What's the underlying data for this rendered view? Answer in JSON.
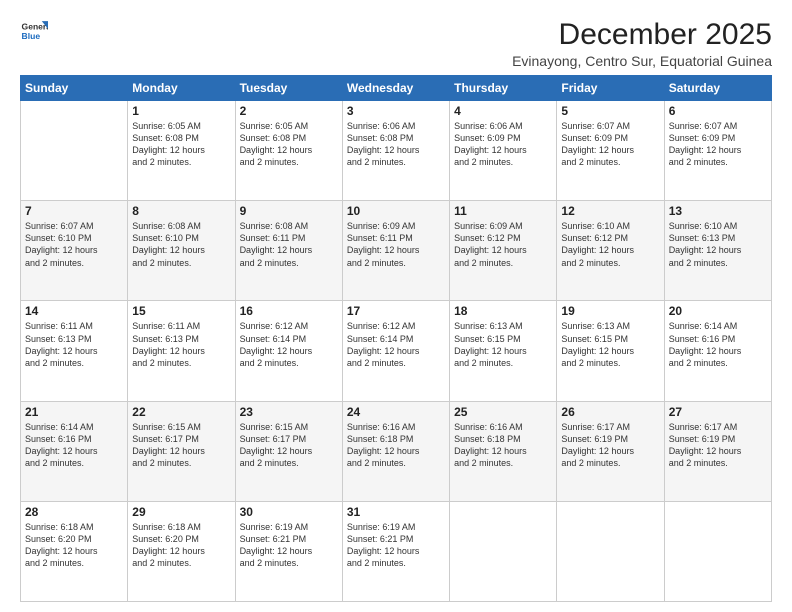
{
  "logo": {
    "general": "General",
    "blue": "Blue"
  },
  "title": "December 2025",
  "subtitle": "Evinayong, Centro Sur, Equatorial Guinea",
  "weekdays": [
    "Sunday",
    "Monday",
    "Tuesday",
    "Wednesday",
    "Thursday",
    "Friday",
    "Saturday"
  ],
  "weeks": [
    [
      {
        "day": "",
        "info": ""
      },
      {
        "day": "1",
        "info": "Sunrise: 6:05 AM\nSunset: 6:08 PM\nDaylight: 12 hours\nand 2 minutes."
      },
      {
        "day": "2",
        "info": "Sunrise: 6:05 AM\nSunset: 6:08 PM\nDaylight: 12 hours\nand 2 minutes."
      },
      {
        "day": "3",
        "info": "Sunrise: 6:06 AM\nSunset: 6:08 PM\nDaylight: 12 hours\nand 2 minutes."
      },
      {
        "day": "4",
        "info": "Sunrise: 6:06 AM\nSunset: 6:09 PM\nDaylight: 12 hours\nand 2 minutes."
      },
      {
        "day": "5",
        "info": "Sunrise: 6:07 AM\nSunset: 6:09 PM\nDaylight: 12 hours\nand 2 minutes."
      },
      {
        "day": "6",
        "info": "Sunrise: 6:07 AM\nSunset: 6:09 PM\nDaylight: 12 hours\nand 2 minutes."
      }
    ],
    [
      {
        "day": "7",
        "info": "Sunrise: 6:07 AM\nSunset: 6:10 PM\nDaylight: 12 hours\nand 2 minutes."
      },
      {
        "day": "8",
        "info": "Sunrise: 6:08 AM\nSunset: 6:10 PM\nDaylight: 12 hours\nand 2 minutes."
      },
      {
        "day": "9",
        "info": "Sunrise: 6:08 AM\nSunset: 6:11 PM\nDaylight: 12 hours\nand 2 minutes."
      },
      {
        "day": "10",
        "info": "Sunrise: 6:09 AM\nSunset: 6:11 PM\nDaylight: 12 hours\nand 2 minutes."
      },
      {
        "day": "11",
        "info": "Sunrise: 6:09 AM\nSunset: 6:12 PM\nDaylight: 12 hours\nand 2 minutes."
      },
      {
        "day": "12",
        "info": "Sunrise: 6:10 AM\nSunset: 6:12 PM\nDaylight: 12 hours\nand 2 minutes."
      },
      {
        "day": "13",
        "info": "Sunrise: 6:10 AM\nSunset: 6:13 PM\nDaylight: 12 hours\nand 2 minutes."
      }
    ],
    [
      {
        "day": "14",
        "info": "Sunrise: 6:11 AM\nSunset: 6:13 PM\nDaylight: 12 hours\nand 2 minutes."
      },
      {
        "day": "15",
        "info": "Sunrise: 6:11 AM\nSunset: 6:13 PM\nDaylight: 12 hours\nand 2 minutes."
      },
      {
        "day": "16",
        "info": "Sunrise: 6:12 AM\nSunset: 6:14 PM\nDaylight: 12 hours\nand 2 minutes."
      },
      {
        "day": "17",
        "info": "Sunrise: 6:12 AM\nSunset: 6:14 PM\nDaylight: 12 hours\nand 2 minutes."
      },
      {
        "day": "18",
        "info": "Sunrise: 6:13 AM\nSunset: 6:15 PM\nDaylight: 12 hours\nand 2 minutes."
      },
      {
        "day": "19",
        "info": "Sunrise: 6:13 AM\nSunset: 6:15 PM\nDaylight: 12 hours\nand 2 minutes."
      },
      {
        "day": "20",
        "info": "Sunrise: 6:14 AM\nSunset: 6:16 PM\nDaylight: 12 hours\nand 2 minutes."
      }
    ],
    [
      {
        "day": "21",
        "info": "Sunrise: 6:14 AM\nSunset: 6:16 PM\nDaylight: 12 hours\nand 2 minutes."
      },
      {
        "day": "22",
        "info": "Sunrise: 6:15 AM\nSunset: 6:17 PM\nDaylight: 12 hours\nand 2 minutes."
      },
      {
        "day": "23",
        "info": "Sunrise: 6:15 AM\nSunset: 6:17 PM\nDaylight: 12 hours\nand 2 minutes."
      },
      {
        "day": "24",
        "info": "Sunrise: 6:16 AM\nSunset: 6:18 PM\nDaylight: 12 hours\nand 2 minutes."
      },
      {
        "day": "25",
        "info": "Sunrise: 6:16 AM\nSunset: 6:18 PM\nDaylight: 12 hours\nand 2 minutes."
      },
      {
        "day": "26",
        "info": "Sunrise: 6:17 AM\nSunset: 6:19 PM\nDaylight: 12 hours\nand 2 minutes."
      },
      {
        "day": "27",
        "info": "Sunrise: 6:17 AM\nSunset: 6:19 PM\nDaylight: 12 hours\nand 2 minutes."
      }
    ],
    [
      {
        "day": "28",
        "info": "Sunrise: 6:18 AM\nSunset: 6:20 PM\nDaylight: 12 hours\nand 2 minutes."
      },
      {
        "day": "29",
        "info": "Sunrise: 6:18 AM\nSunset: 6:20 PM\nDaylight: 12 hours\nand 2 minutes."
      },
      {
        "day": "30",
        "info": "Sunrise: 6:19 AM\nSunset: 6:21 PM\nDaylight: 12 hours\nand 2 minutes."
      },
      {
        "day": "31",
        "info": "Sunrise: 6:19 AM\nSunset: 6:21 PM\nDaylight: 12 hours\nand 2 minutes."
      },
      {
        "day": "",
        "info": ""
      },
      {
        "day": "",
        "info": ""
      },
      {
        "day": "",
        "info": ""
      }
    ]
  ]
}
